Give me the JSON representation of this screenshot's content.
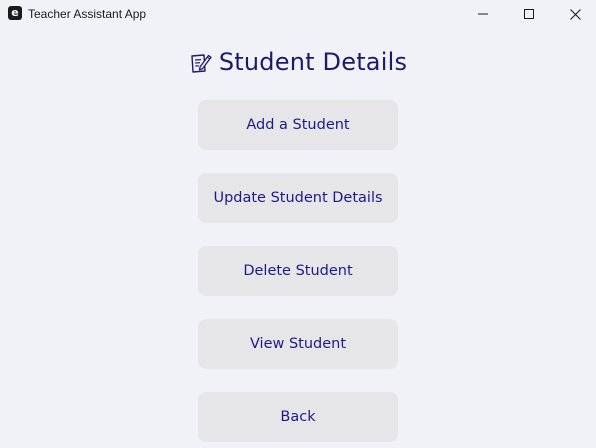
{
  "window": {
    "app_icon_letter": "e",
    "title": "Teacher Assistant App",
    "controls": {
      "minimize": "minimize-icon",
      "maximize": "maximize-icon",
      "close": "close-icon"
    }
  },
  "page": {
    "icon": "memo-pencil-icon",
    "title": "Student Details"
  },
  "menu": {
    "add_label": "Add a Student",
    "update_label": "Update Student Details",
    "delete_label": "Delete Student",
    "view_label": "View Student",
    "back_label": "Back"
  },
  "colors": {
    "background": "#f1f2f7",
    "button_bg": "#e6e6e9",
    "accent_text": "#1c1a8a",
    "heading_text": "#1c1a6b"
  }
}
